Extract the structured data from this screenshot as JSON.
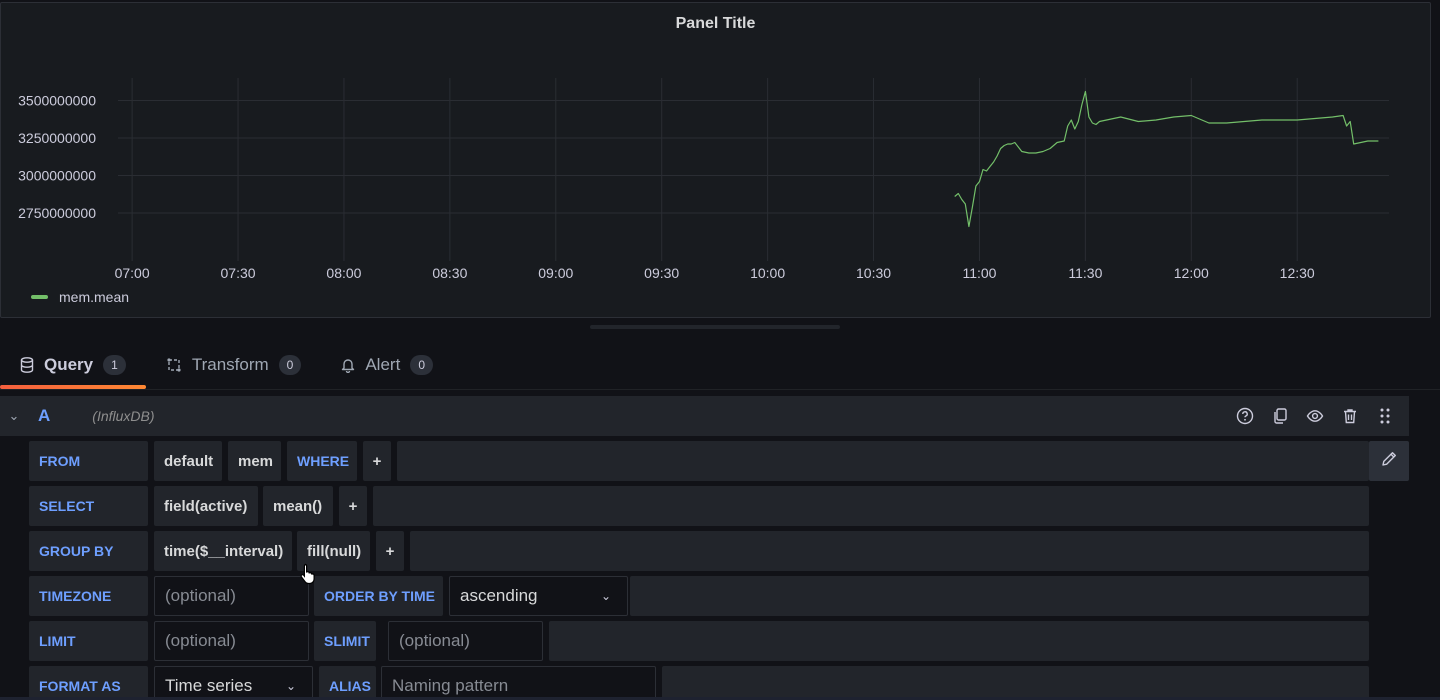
{
  "panel": {
    "title": "Panel Title"
  },
  "chart_data": {
    "type": "line",
    "title": "Panel Title",
    "xlabel": "",
    "ylabel": "",
    "ylim": [
      2550000000,
      3650000000
    ],
    "xlim": [
      "06:56",
      "12:56"
    ],
    "grid": true,
    "legend_placement": "bottom-left",
    "yticks": [
      "2750000000",
      "3000000000",
      "3250000000",
      "3500000000"
    ],
    "xticks": [
      "07:00",
      "07:30",
      "08:00",
      "08:30",
      "09:00",
      "09:30",
      "10:00",
      "10:30",
      "11:00",
      "11:30",
      "12:00",
      "12:30"
    ],
    "series": [
      {
        "name": "mem.mean",
        "color": "#73bf69",
        "x": [
          "10:53",
          "10:54",
          "10:55",
          "10:56",
          "10:57",
          "10:58",
          "10:59",
          "11:00",
          "11:01",
          "11:02",
          "11:03",
          "11:04",
          "11:05",
          "11:06",
          "11:07",
          "11:08",
          "11:09",
          "11:10",
          "11:12",
          "11:14",
          "11:16",
          "11:18",
          "11:20",
          "11:22",
          "11:24",
          "11:25",
          "11:26",
          "11:27",
          "11:28",
          "11:29",
          "11:30",
          "11:31",
          "11:32",
          "11:33",
          "11:34",
          "11:36",
          "11:38",
          "11:40",
          "11:45",
          "11:50",
          "11:55",
          "12:00",
          "12:05",
          "12:10",
          "12:15",
          "12:20",
          "12:25",
          "12:30",
          "12:35",
          "12:40",
          "12:43",
          "12:44",
          "12:45",
          "12:46",
          "12:48",
          "12:50",
          "12:53"
        ],
        "values": [
          2860000000,
          2880000000,
          2840000000,
          2810000000,
          2660000000,
          2790000000,
          2930000000,
          2960000000,
          3040000000,
          3030000000,
          3060000000,
          3090000000,
          3130000000,
          3180000000,
          3200000000,
          3210000000,
          3210000000,
          3220000000,
          3160000000,
          3150000000,
          3150000000,
          3160000000,
          3180000000,
          3220000000,
          3230000000,
          3330000000,
          3370000000,
          3310000000,
          3360000000,
          3470000000,
          3560000000,
          3390000000,
          3350000000,
          3340000000,
          3360000000,
          3370000000,
          3380000000,
          3390000000,
          3360000000,
          3370000000,
          3390000000,
          3400000000,
          3350000000,
          3350000000,
          3360000000,
          3370000000,
          3370000000,
          3370000000,
          3380000000,
          3390000000,
          3400000000,
          3330000000,
          3360000000,
          3210000000,
          3220000000,
          3230000000,
          3230000000
        ]
      }
    ]
  },
  "tabs": [
    {
      "label": "Query",
      "count": "1",
      "icon": "database-icon"
    },
    {
      "label": "Transform",
      "count": "0",
      "icon": "transform-icon"
    },
    {
      "label": "Alert",
      "count": "0",
      "icon": "bell-icon"
    }
  ],
  "query": {
    "ref_id": "A",
    "datasource": "(InfluxDB)",
    "from": {
      "keyword": "FROM",
      "policy": "default",
      "measurement": "mem",
      "where": "WHERE",
      "plus": "+"
    },
    "select": {
      "keyword": "SELECT",
      "field": "field(active)",
      "func": "mean()",
      "plus": "+"
    },
    "group_by": {
      "keyword": "GROUP BY",
      "time": "time($__interval)",
      "fill": "fill(null)",
      "plus": "+"
    },
    "timezone": {
      "keyword": "TIMEZONE",
      "placeholder": "(optional)"
    },
    "order_by_time": {
      "keyword": "ORDER BY TIME",
      "value": "ascending"
    },
    "limit": {
      "keyword": "LIMIT",
      "placeholder": "(optional)"
    },
    "slimit": {
      "keyword": "SLIMIT",
      "placeholder": "(optional)"
    },
    "format_as": {
      "keyword": "FORMAT AS",
      "value": "Time series"
    },
    "alias": {
      "keyword": "ALIAS",
      "placeholder": "Naming pattern"
    }
  },
  "colors": {
    "accent": "#6e9fff",
    "series": "#73bf69",
    "tab_underline": "#f55f3e"
  }
}
